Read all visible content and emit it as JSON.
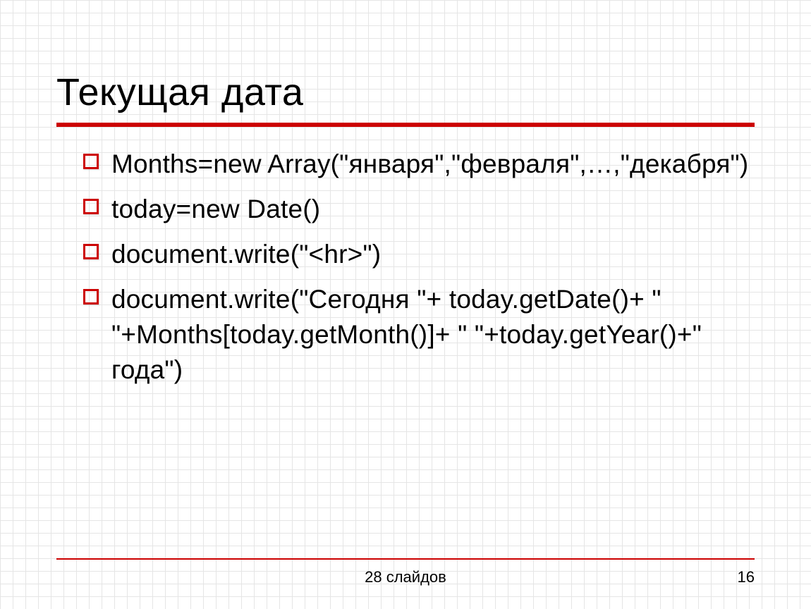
{
  "slide": {
    "title": "Текущая дата",
    "bullets": [
      "Months=new Array(\"января\",\"февраля\",…,\"декабря\")",
      "today=new Date()",
      "document.write(\"<hr>\")",
      "document.write(\"Сегодня \"+ today.getDate()+ \" \"+Months[today.getMonth()]+ \" \"+today.getYear()+\" года\")"
    ],
    "footer_center": "28 слайдов",
    "footer_right": "16"
  }
}
